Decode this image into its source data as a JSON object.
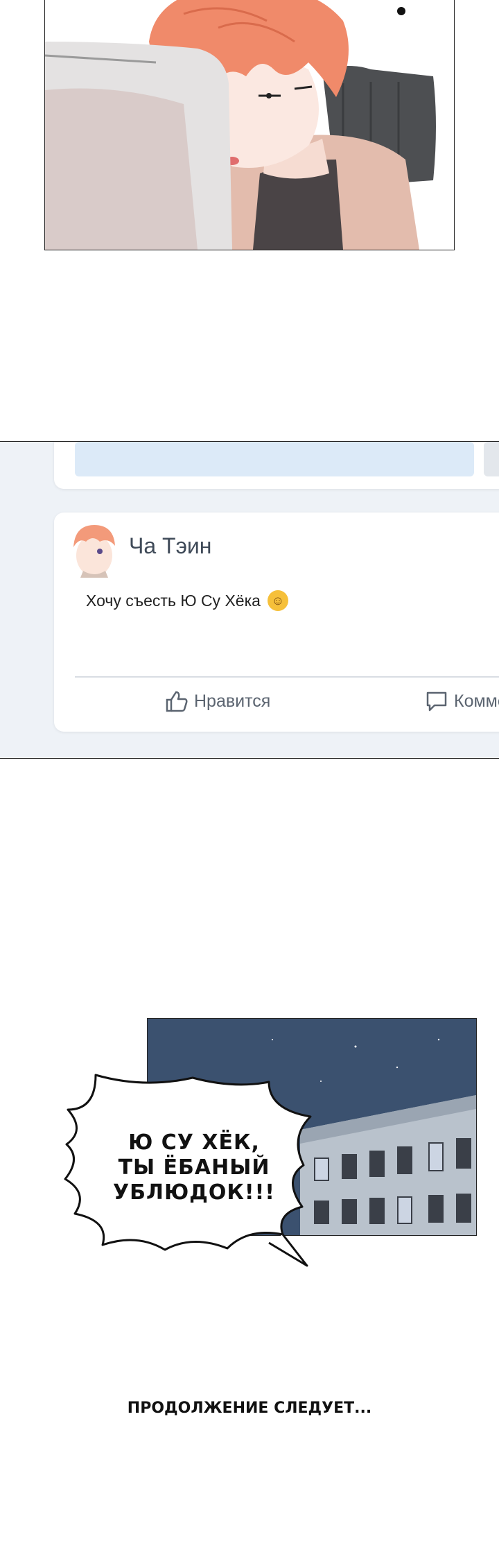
{
  "post": {
    "author": "Ча Тэин",
    "text": "Хочу съесть Ю Су Хёка",
    "emoji": "smiling-face-icon",
    "like_label": "Нравится",
    "comment_label": "Комме"
  },
  "speech_bubble": {
    "line1": "Ю СУ ХЁК,",
    "line2": "ТЫ ЁБАНЫЙ",
    "line3": "УБЛЮДОК!!!"
  },
  "caption": "ПРОДОЛЖЕНИЕ СЛЕДУЕТ...",
  "colors": {
    "feed_background": "#eef2f7",
    "author_text": "#3f4a58",
    "night_sky": "#3b516f",
    "hair": "#f08a6a"
  }
}
